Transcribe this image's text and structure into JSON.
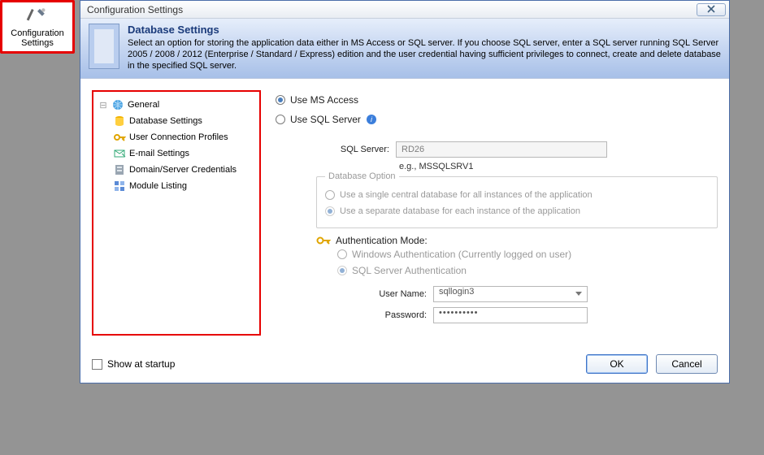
{
  "launcher": {
    "label1": "Configuration",
    "label2": "Settings"
  },
  "dialog": {
    "title": "Configuration Settings",
    "header_title": "Database Settings",
    "header_desc": "Select an option for storing the application data either in MS Access or SQL server. If you choose SQL server, enter a SQL server running SQL Server 2005 / 2008 / 2012 (Enterprise / Standard / Express) edition and the user credential having sufficient privileges to connect, create and delete database in the specified SQL server."
  },
  "tree": {
    "root": "General",
    "items": [
      "Database Settings",
      "User Connection Profiles",
      "E-mail Settings",
      "Domain/Server Credentials",
      "Module Listing"
    ]
  },
  "form": {
    "use_access": "Use MS Access",
    "use_sql": "Use SQL Server",
    "sql_label": "SQL Server:",
    "sql_value": "RD26",
    "sql_hint": "e.g., MSSQLSRV1",
    "dbopt_title": "Database Option",
    "dbopt1": "Use a single central database for all instances of the application",
    "dbopt2": "Use a separate database for each instance of the application",
    "auth_label": "Authentication Mode:",
    "auth_win": "Windows Authentication (Currently logged on user)",
    "auth_sql": "SQL Server Authentication",
    "user_label": "User Name:",
    "user_value": "sqllogin3",
    "pass_label": "Password:",
    "pass_value": "••••••••••"
  },
  "footer": {
    "show": "Show at startup",
    "ok": "OK",
    "cancel": "Cancel"
  }
}
